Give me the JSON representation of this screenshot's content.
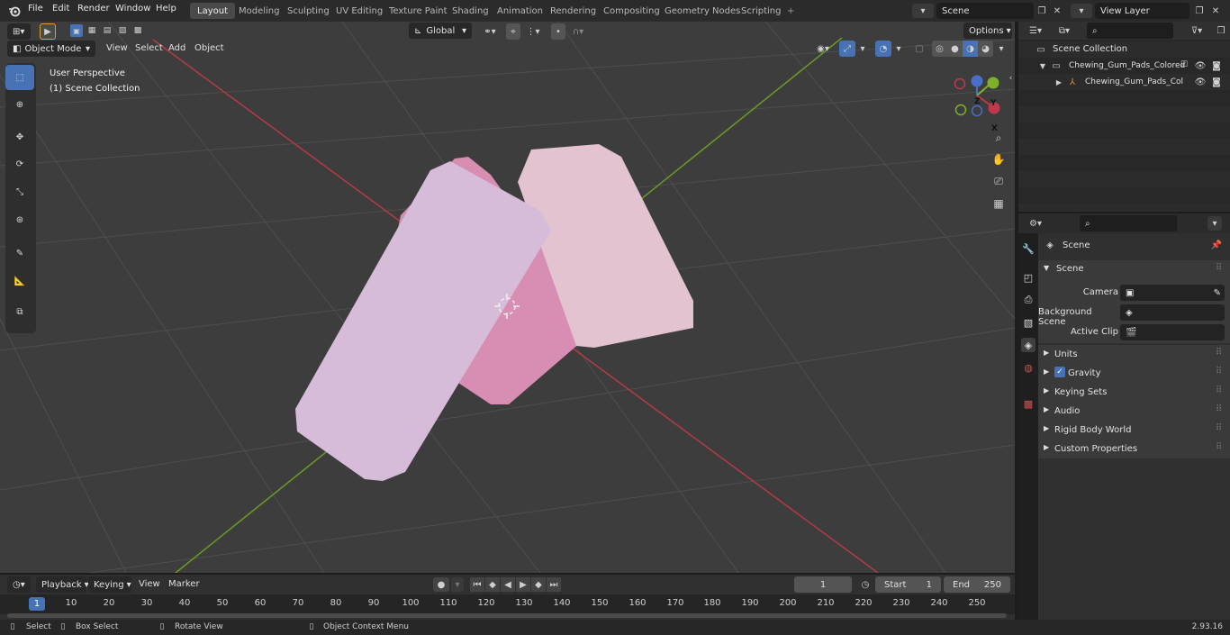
{
  "topbar": {
    "menus": [
      "File",
      "Edit",
      "Render",
      "Window",
      "Help"
    ],
    "workspaces": [
      "Layout",
      "Modeling",
      "Sculpting",
      "UV Editing",
      "Texture Paint",
      "Shading",
      "Animation",
      "Rendering",
      "Compositing",
      "Geometry Nodes",
      "Scripting"
    ],
    "active_workspace": "Layout",
    "add_tab": "+",
    "scene_name": "Scene",
    "view_layer_name": "View Layer"
  },
  "viewport": {
    "mode": "Object Mode",
    "menus": [
      "View",
      "Select",
      "Add",
      "Object"
    ],
    "transform_orientation": "Global",
    "options_label": "Options",
    "info_line1": "User Perspective",
    "info_line2": "(1) Scene Collection",
    "gizmo_axes": {
      "z": "Z",
      "y": "Y",
      "x": "X"
    },
    "colors": {
      "x_axis": "#c0394a",
      "y_axis": "#7fb02a",
      "active_tool": "#4772b3"
    }
  },
  "outliner": {
    "root": "Scene Collection",
    "items": [
      {
        "label": "Chewing_Gum_Pads_Colored"
      },
      {
        "label": "Chewing_Gum_Pads_Col"
      }
    ]
  },
  "properties": {
    "header": "Scene",
    "section": "Scene",
    "fields": [
      {
        "label": "Camera"
      },
      {
        "label": "Background Scene"
      },
      {
        "label": "Active Clip"
      }
    ],
    "panels": [
      "Units",
      "Gravity",
      "Keying Sets",
      "Audio",
      "Rigid Body World",
      "Custom Properties"
    ],
    "gravity_checked": true
  },
  "timeline": {
    "menus": [
      "Playback",
      "Keying",
      "View",
      "Marker"
    ],
    "current_frame": "1",
    "start_label": "Start",
    "start_value": "1",
    "end_label": "End",
    "end_value": "250",
    "ruler_current": "1",
    "ruler_ticks": [
      "10",
      "20",
      "30",
      "40",
      "50",
      "60",
      "70",
      "80",
      "90",
      "100",
      "110",
      "120",
      "130",
      "140",
      "150",
      "160",
      "170",
      "180",
      "190",
      "200",
      "210",
      "220",
      "230",
      "240",
      "250"
    ]
  },
  "statusbar": {
    "items": [
      "Select",
      "Box Select",
      "Rotate View",
      "Object Context Menu"
    ],
    "version": "2.93.16"
  }
}
